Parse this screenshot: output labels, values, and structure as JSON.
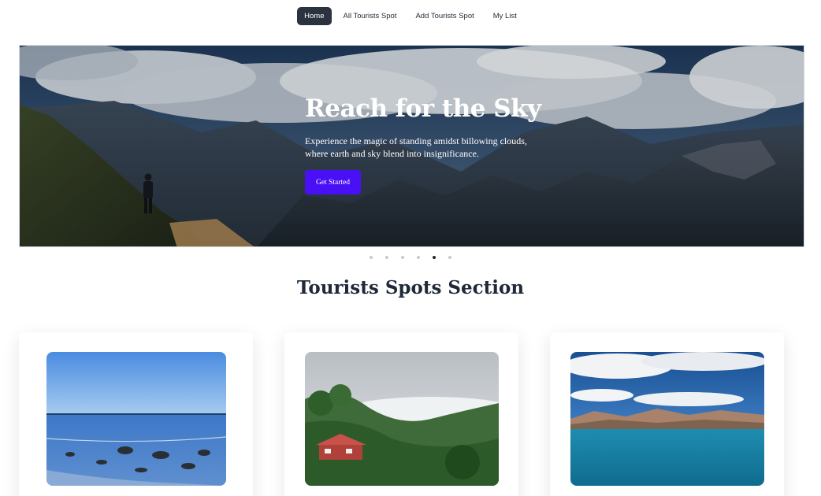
{
  "nav": {
    "items": [
      {
        "label": "Home",
        "active": true
      },
      {
        "label": "All Tourists Spot",
        "active": false
      },
      {
        "label": "Add Tourists Spot",
        "active": false
      },
      {
        "label": "My List",
        "active": false
      }
    ]
  },
  "hero": {
    "title": "Reach for the Sky",
    "subtitle": "Experience the magic of standing amidst billowing clouds, where earth and sky blend into insignificance.",
    "button_label": "Get Started",
    "slides_total": 6,
    "active_slide": 5
  },
  "section": {
    "title": "Tourists Spots Section"
  },
  "cards": [
    {
      "image": "beach-photo"
    },
    {
      "image": "forest-village-photo"
    },
    {
      "image": "lake-mountains-photo"
    }
  ],
  "colors": {
    "nav_active_bg": "#2b3340",
    "accent_button": "#4a10f5",
    "dot_active": "#1f2937",
    "dot_inactive": "#c7cbd1"
  }
}
